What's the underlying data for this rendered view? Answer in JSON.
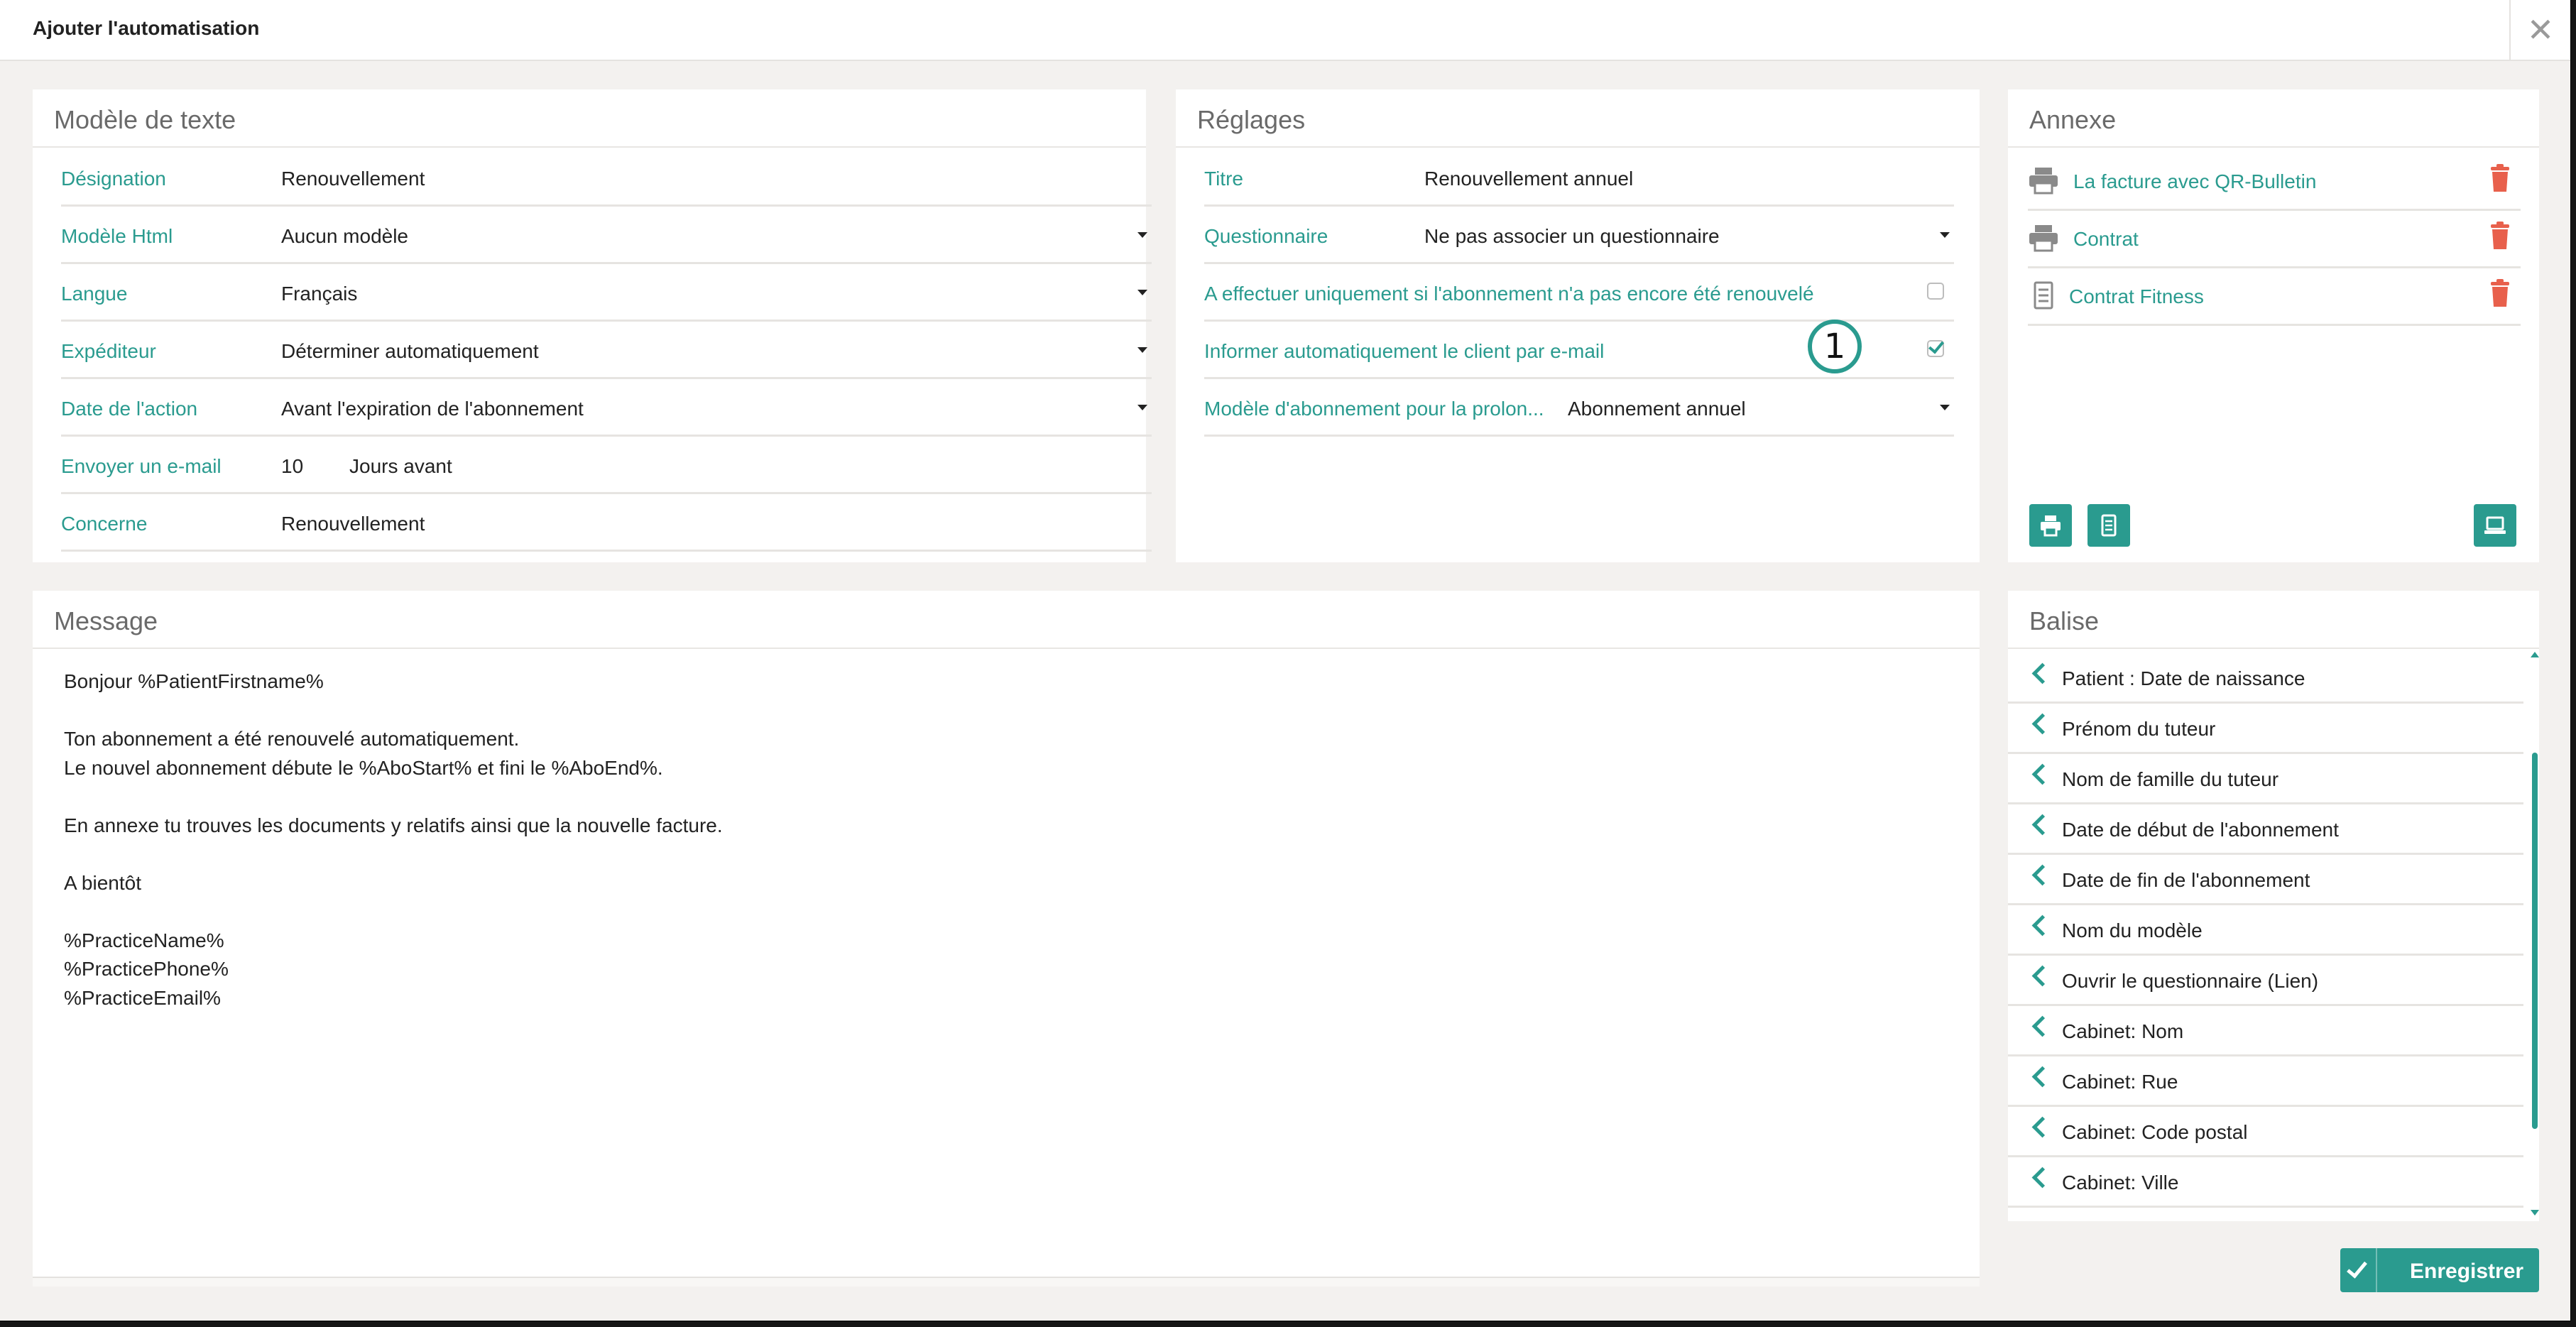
{
  "window": {
    "title": "Ajouter l'automatisation"
  },
  "template": {
    "title": "Modèle de texte",
    "fields": [
      {
        "label": "Désignation",
        "value": "Renouvellement"
      },
      {
        "label": "Modèle Html",
        "value": "Aucun modèle"
      },
      {
        "label": "Langue",
        "value": "Français"
      },
      {
        "label": "Expéditeur",
        "value": "Déterminer automatiquement"
      },
      {
        "label": "Date de l'action",
        "value": "Avant l'expiration de l'abonnement"
      },
      {
        "label": "Envoyer un e-mail",
        "value": "10",
        "unit": "Jours avant"
      },
      {
        "label": "Concerne",
        "value": "Renouvellement"
      }
    ]
  },
  "settings": {
    "title": "Réglages",
    "titre": {
      "label": "Titre",
      "value": "Renouvellement annuel"
    },
    "questionnaire": {
      "label": "Questionnaire",
      "value": "Ne pas associer un questionnaire"
    },
    "only_if_not_renewed": {
      "label": "A effectuer uniquement si l'abonnement n'a pas encore été renouvelé",
      "checked": false
    },
    "inform_client": {
      "label": "Informer automatiquement le client par e-mail",
      "checked": true
    },
    "subscription_model": {
      "label": "Modèle d'abonnement pour la prolon...",
      "value": "Abonnement annuel"
    },
    "callout": "1"
  },
  "attachments": {
    "title": "Annexe",
    "items": [
      {
        "label": "La facture avec QR-Bulletin",
        "icon": "printer-icon"
      },
      {
        "label": "Contrat",
        "icon": "printer-icon"
      },
      {
        "label": "Contrat Fitness",
        "icon": "document-icon"
      }
    ]
  },
  "message": {
    "title": "Message",
    "body": "Bonjour %PatientFirstname%\n\nTon abonnement a été renouvelé automatiquement.\nLe nouvel abonnement débute le %AboStart% et fini le %AboEnd%.\n\nEn annexe tu trouves les documents y relatifs ainsi que la nouvelle facture.\n\nA bientôt\n\n%PracticeName%\n%PracticePhone%\n%PracticeEmail%"
  },
  "tags": {
    "title": "Balise",
    "items": [
      "Patient : Date de naissance",
      "Prénom du tuteur",
      "Nom de famille du tuteur",
      "Date de début de l'abonnement",
      "Date de fin de l'abonnement",
      "Nom du modèle",
      "Ouvrir le questionnaire (Lien)",
      "Cabinet: Nom",
      "Cabinet: Rue",
      "Cabinet: Code postal",
      "Cabinet: Ville"
    ]
  },
  "actions": {
    "save_label": "Enregistrer"
  },
  "colors": {
    "accent": "#2a9b8f",
    "delete": "#e8604c",
    "background": "#f3f1ef"
  }
}
